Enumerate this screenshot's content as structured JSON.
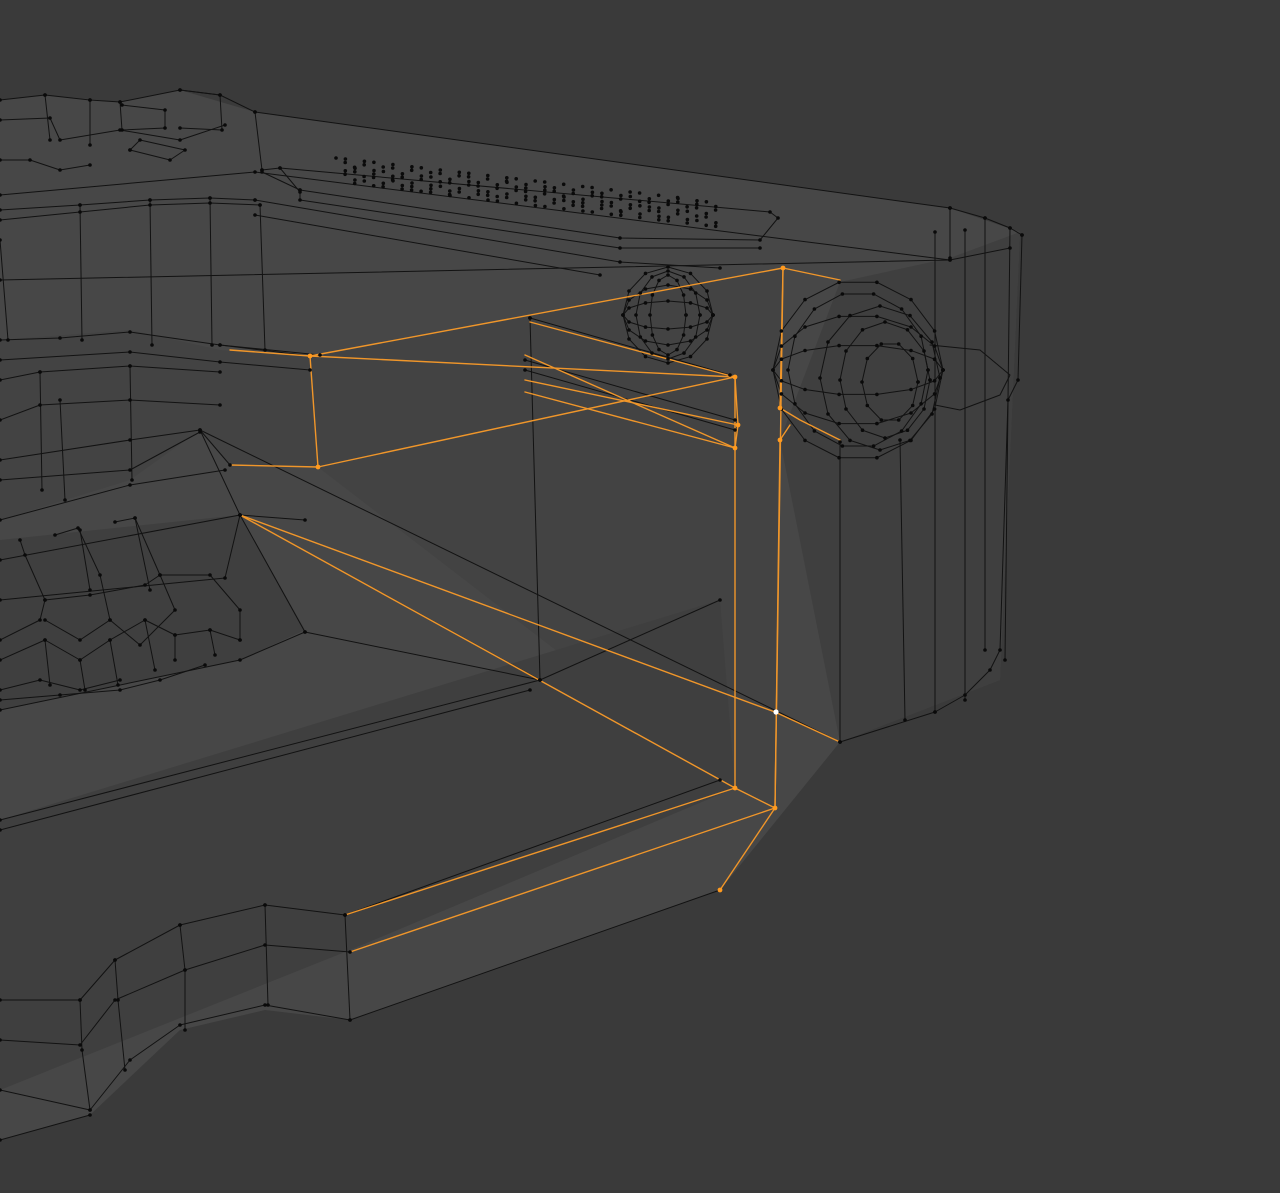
{
  "viewport": {
    "mode": "edit-mode-wireframe",
    "colors": {
      "background": "#3a3a3a",
      "mesh_face_light": "#474747",
      "mesh_face_mid": "#434343",
      "mesh_face_dark": "#3f3f3f",
      "wire": "#121212",
      "vertex": "#0a0a0a",
      "selected_wire": "#f0962a",
      "selected_vertex": "#ff9a1f",
      "active_vertex": "#ffffff"
    }
  }
}
